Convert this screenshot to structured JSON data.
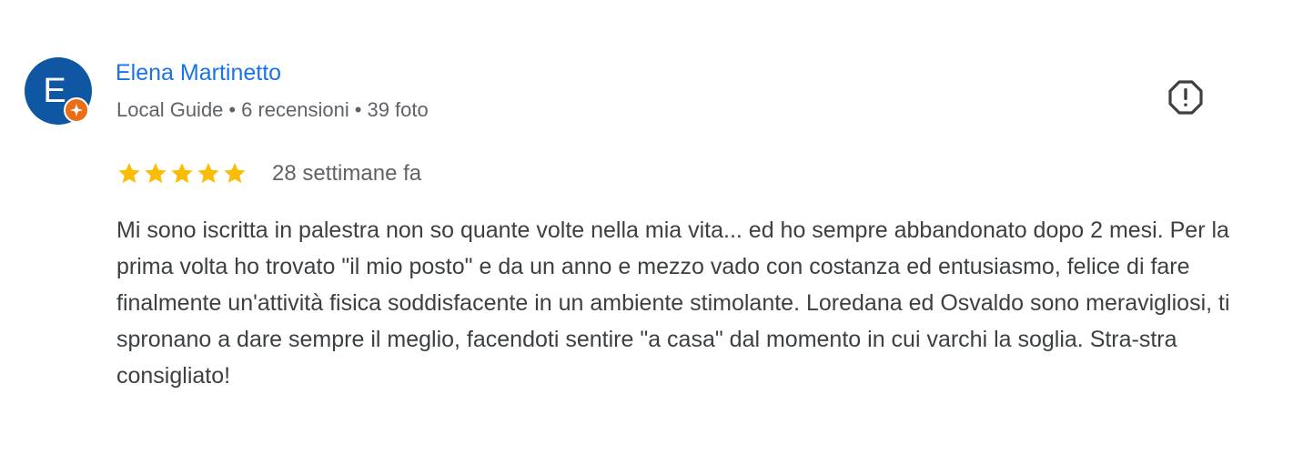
{
  "reviewer": {
    "initial": "E",
    "name": "Elena Martinetto",
    "badge_icon": "local-guide-badge-icon",
    "level": "Local Guide",
    "reviews_count": "6 recensioni",
    "photos_count": "39 foto",
    "separator": "•"
  },
  "review": {
    "rating": 5,
    "rating_max": 5,
    "date": "28 settimane fa",
    "text": "Mi sono iscritta in palestra non so quante volte nella mia vita... ed ho sempre abbandonato dopo 2 mesi. Per la prima volta ho trovato \"il mio posto\" e da un anno e mezzo vado con costanza ed entusiasmo, felice di fare finalmente un'attività fisica soddisfacente in un ambiente stimolante. Loredana ed Osvaldo sono meravigliosi, ti spronano a dare sempre il meglio, facendoti sentire \"a casa\" dal momento in cui varchi la soglia. Stra-stra consigliato!"
  },
  "actions": {
    "flag_icon": "report-flag-icon"
  },
  "colors": {
    "avatar_bg": "#0f56a3",
    "badge_bg": "#ea6e16",
    "name_link": "#1a73e8",
    "star": "#fbbc04",
    "meta_text": "#5f6368",
    "body_text": "#3c4043"
  }
}
